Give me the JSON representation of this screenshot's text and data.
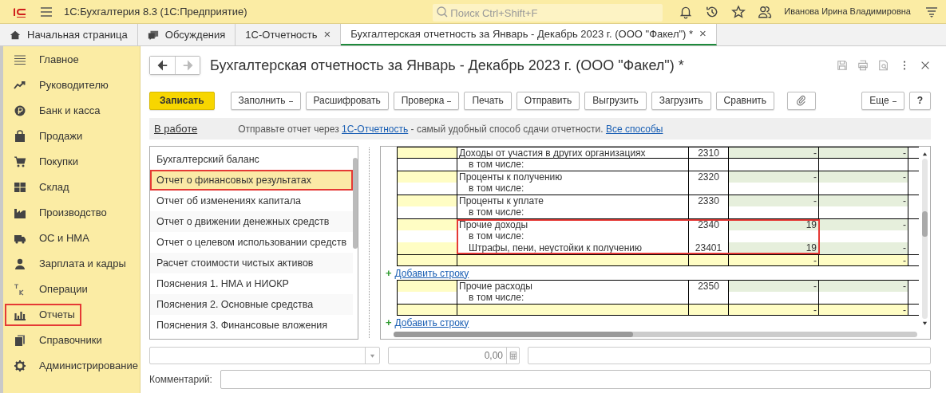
{
  "app": {
    "title": "1С:Бухгалтерия 8.3  (1С:Предприятие)",
    "search_placeholder": "Поиск Ctrl+Shift+F",
    "user": "Иванова Ирина Владимировна"
  },
  "tabs": [
    {
      "label": "Начальная страница",
      "selected": false,
      "closable": false
    },
    {
      "label": "Обсуждения",
      "selected": false,
      "closable": false
    },
    {
      "label": "1С-Отчетность",
      "selected": false,
      "closable": true
    },
    {
      "label": "Бухгалтерская отчетность за Январь - Декабрь 2023 г. (ООО \"Факел\") *",
      "selected": true,
      "closable": true
    }
  ],
  "close_glyph": "×",
  "sidebar": {
    "items": [
      {
        "label": "Главное",
        "highlighted": false
      },
      {
        "label": "Руководителю",
        "highlighted": false
      },
      {
        "label": "Банк и касса",
        "highlighted": false
      },
      {
        "label": "Продажи",
        "highlighted": false
      },
      {
        "label": "Покупки",
        "highlighted": false
      },
      {
        "label": "Склад",
        "highlighted": false
      },
      {
        "label": "Производство",
        "highlighted": false
      },
      {
        "label": "ОС и НМА",
        "highlighted": false
      },
      {
        "label": "Зарплата и кадры",
        "highlighted": false
      },
      {
        "label": "Операции",
        "highlighted": false
      },
      {
        "label": "Отчеты",
        "highlighted": true
      },
      {
        "label": "Справочники",
        "highlighted": false
      },
      {
        "label": "Администрирование",
        "highlighted": false
      }
    ]
  },
  "form": {
    "title": "Бухгалтерская отчетность за Январь - Декабрь 2023 г. (ООО \"Факел\") *",
    "toolbar": [
      {
        "label": "Записать",
        "kind": "primary"
      },
      {
        "label": "Заполнить",
        "kind": "dropdown"
      },
      {
        "label": "Расшифровать",
        "kind": "plain"
      },
      {
        "label": "Проверка",
        "kind": "dropdown"
      },
      {
        "label": "Печать",
        "kind": "plain"
      },
      {
        "label": "Отправить",
        "kind": "plain"
      },
      {
        "label": "Выгрузить",
        "kind": "plain"
      },
      {
        "label": "Загрузить",
        "kind": "plain"
      },
      {
        "label": "Сравнить",
        "kind": "plain"
      },
      {
        "kind": "attach"
      },
      {
        "label": "Еще",
        "kind": "more"
      },
      {
        "label": "?",
        "kind": "help"
      }
    ],
    "status_link": "В работе",
    "info": {
      "before": "Отправьте отчет через",
      "link": "1С-Отчетность",
      "after": "- самый удобный способ сдачи отчетности.",
      "link2": "Все способы"
    },
    "sections": [
      {
        "label": "Бухгалтерский баланс",
        "selected": false
      },
      {
        "label": "Отчет о финансовых результатах",
        "selected": true
      },
      {
        "label": "Отчет об изменениях капитала",
        "selected": false
      },
      {
        "label": "Отчет о движении денежных средств",
        "selected": false
      },
      {
        "label": "Отчет о целевом использовании средств",
        "selected": false
      },
      {
        "label": "Расчет стоимости чистых активов",
        "selected": false
      },
      {
        "label": "Пояснения 1. НМА и НИОКР",
        "selected": false
      },
      {
        "label": "Пояснения 2. Основные средства",
        "selected": false
      },
      {
        "label": "Пояснения 3. Финансовые вложения",
        "selected": false
      }
    ],
    "grid_rows": [
      {
        "kind": "line",
        "name": "Доходы от участия в других организациях",
        "code": "2310",
        "value_1": "-",
        "value_2": "-",
        "highlighted": false
      },
      {
        "kind": "note",
        "name": "в том числе:",
        "highlighted": false
      },
      {
        "kind": "line",
        "name": "Проценты к получению",
        "code": "2320",
        "value_1": "-",
        "value_2": "-",
        "highlighted": false
      },
      {
        "kind": "note",
        "name": "в том числе:",
        "highlighted": false
      },
      {
        "kind": "line",
        "name": "Проценты к уплате",
        "code": "2330",
        "value_1": "-",
        "value_2": "-",
        "highlighted": false
      },
      {
        "kind": "note",
        "name": "в том числе:",
        "highlighted": false
      },
      {
        "kind": "line",
        "name": "Прочие доходы",
        "code": "2340",
        "value_1": "19",
        "value_2": "-",
        "highlighted": true
      },
      {
        "kind": "note",
        "name": "в том числе:",
        "highlighted": true
      },
      {
        "kind": "detail",
        "name": "Штрафы, пени, неустойки к получению",
        "code": "23401",
        "value_1": "19",
        "value_2": "-",
        "highlighted": true
      },
      {
        "kind": "input",
        "value_1": "-",
        "value_2": "-",
        "highlighted": false
      },
      {
        "kind": "add",
        "name": "Добавить строку",
        "glyph": "+"
      },
      {
        "kind": "line",
        "name": "Прочие расходы",
        "code": "2350",
        "value_1": "-",
        "value_2": "-",
        "highlighted": false
      },
      {
        "kind": "note",
        "name": "в том числе:",
        "highlighted": false
      },
      {
        "kind": "input",
        "value_1": "-",
        "value_2": "-",
        "highlighted": false
      },
      {
        "kind": "add",
        "name": "Добавить строку",
        "glyph": "+"
      }
    ],
    "amount": "0,00",
    "comment_label": "Комментарий:"
  }
}
